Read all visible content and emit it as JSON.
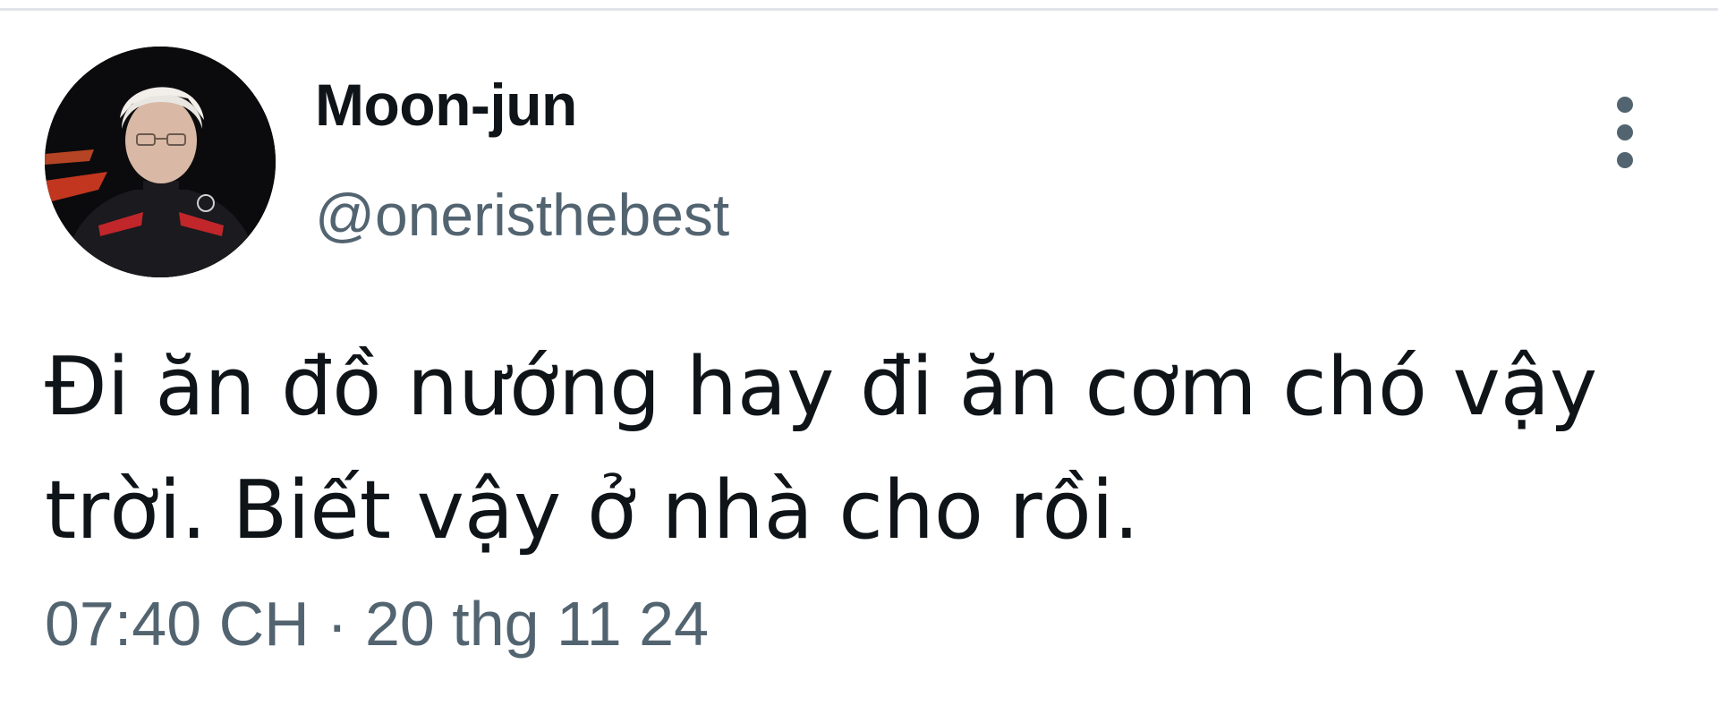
{
  "tweet": {
    "author": {
      "display_name": "Moon-jun",
      "handle": "@oneristhebest",
      "avatar_icon": "user-avatar-photo"
    },
    "text": "Đi ăn đồ nướng hay đi ăn cơm chó vậy trời. Biết vậy ở nhà cho rồi.",
    "time": "07:40 CH",
    "separator": " · ",
    "date": "20 thg 11 24",
    "more_icon": "more-vertical-icon"
  },
  "colors": {
    "primary_text": "#0f1419",
    "secondary_text": "#536471",
    "background": "#ffffff",
    "divider": "#e1e4e8"
  }
}
